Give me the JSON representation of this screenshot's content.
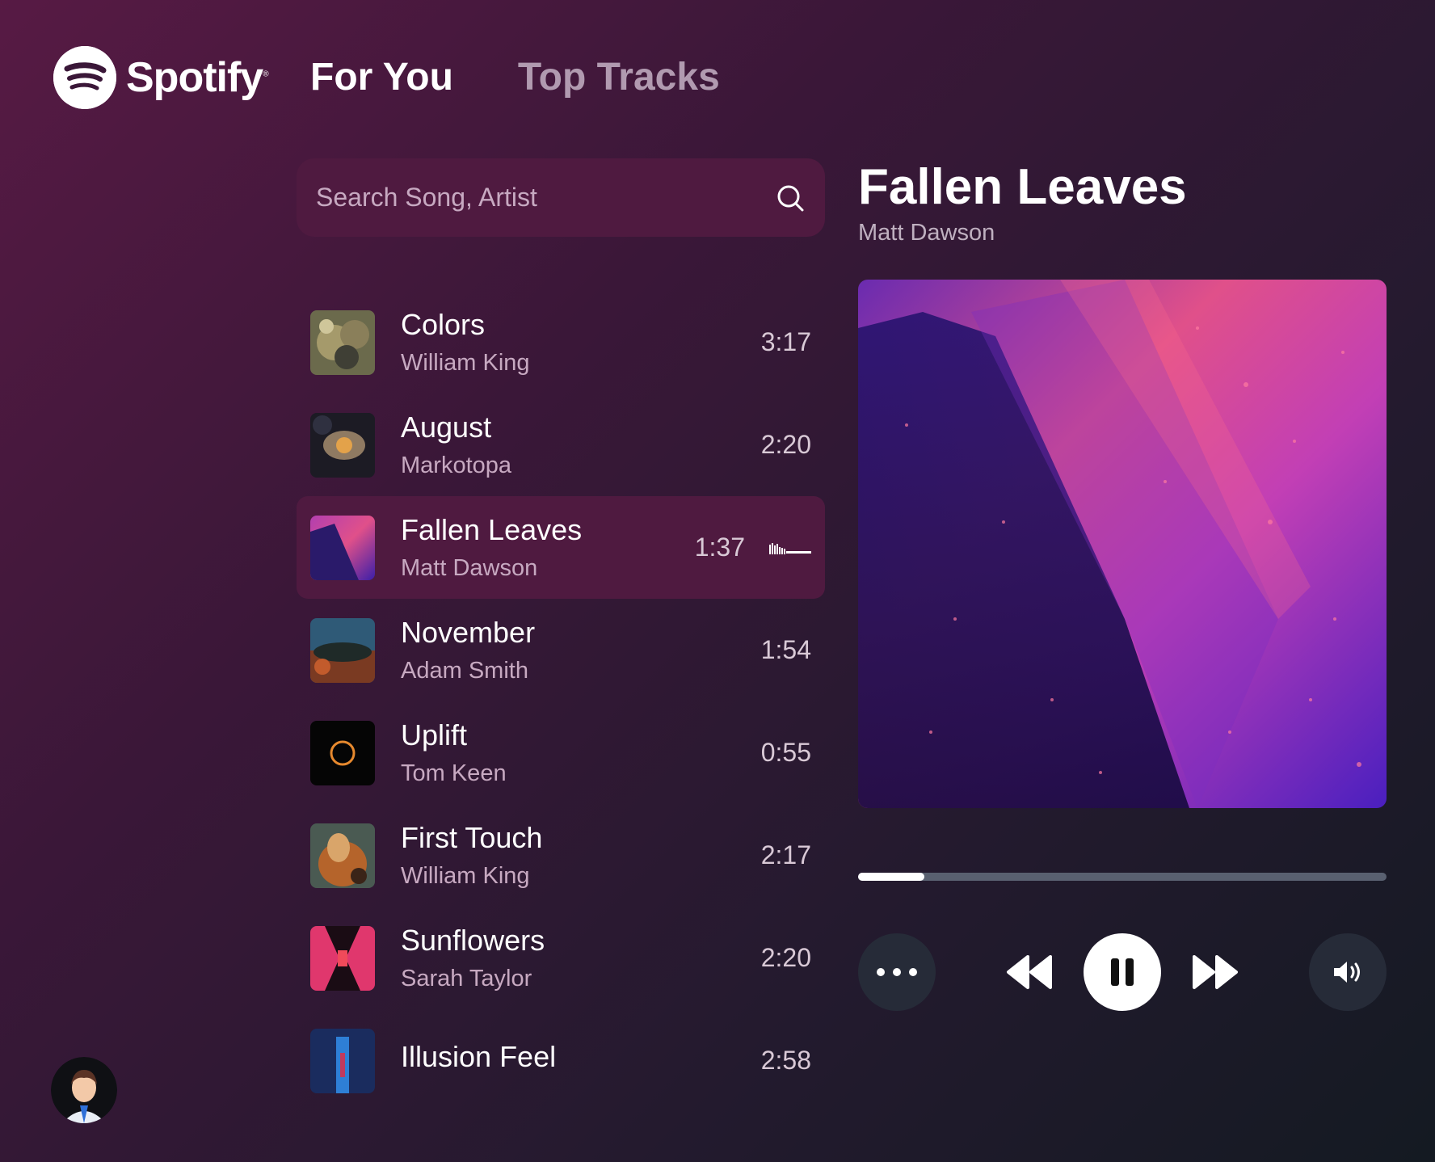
{
  "app": {
    "brand": "Spotify",
    "brand_mark": "®"
  },
  "nav": {
    "tabs": [
      {
        "label": "For You",
        "active": true
      },
      {
        "label": "Top Tracks",
        "active": false
      }
    ]
  },
  "search": {
    "placeholder": "Search Song, Artist",
    "value": "",
    "icon": "search-icon"
  },
  "tracks": [
    {
      "title": "Colors",
      "artist": "William King",
      "duration": "3:17"
    },
    {
      "title": "August",
      "artist": "Markotopa",
      "duration": "2:20"
    },
    {
      "title": "Fallen Leaves",
      "artist": "Matt Dawson",
      "duration": "1:37",
      "playing": true
    },
    {
      "title": "November",
      "artist": "Adam Smith",
      "duration": "1:54"
    },
    {
      "title": "Uplift",
      "artist": "Tom Keen",
      "duration": "0:55"
    },
    {
      "title": "First Touch",
      "artist": "William King",
      "duration": "2:17"
    },
    {
      "title": "Sunflowers",
      "artist": "Sarah Taylor",
      "duration": "2:20"
    },
    {
      "title": "Illusion Feel",
      "artist": "",
      "duration": "2:58"
    }
  ],
  "now_playing": {
    "title": "Fallen Leaves",
    "artist": "Matt Dawson",
    "progress_fraction": 0.126
  },
  "controls": {
    "icons": [
      "more-icon",
      "rewind-icon",
      "pause-icon",
      "fast-forward-icon",
      "volume-icon"
    ]
  },
  "colors": {
    "accent_bg": "#4f1a40",
    "muted_text": "#c7a9c1",
    "control_bg": "#262b38",
    "progress_track": "#596070"
  }
}
